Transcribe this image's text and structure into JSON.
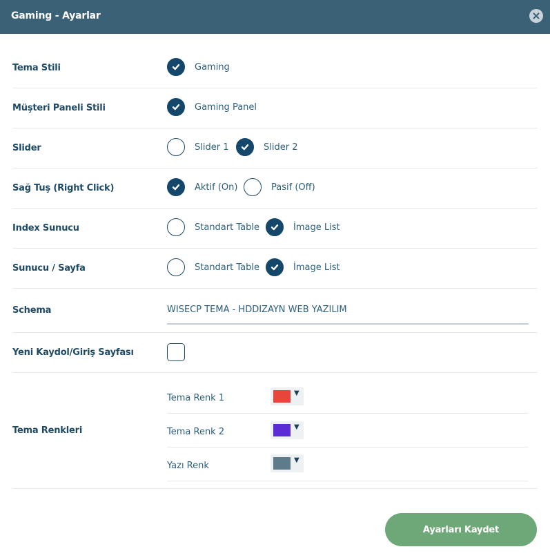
{
  "header": {
    "title": "Gaming - Ayarlar"
  },
  "rows": {
    "tema_stili": {
      "label": "Tema Stili",
      "options": [
        {
          "label": "Gaming",
          "checked": true
        }
      ]
    },
    "musteri_paneli": {
      "label": "Müşteri Paneli Stili",
      "options": [
        {
          "label": "Gaming Panel",
          "checked": true
        }
      ]
    },
    "slider": {
      "label": "Slider",
      "options": [
        {
          "label": "Slider 1",
          "checked": false
        },
        {
          "label": "Slider 2",
          "checked": true
        }
      ]
    },
    "sag_tus": {
      "label": "Sağ Tuş (Right Click)",
      "options": [
        {
          "label": "Aktif (On)",
          "checked": true
        },
        {
          "label": "Pasif (Off)",
          "checked": false
        }
      ]
    },
    "index_sunucu": {
      "label": "Index Sunucu",
      "options": [
        {
          "label": "Standart Table",
          "checked": false
        },
        {
          "label": "İmage List",
          "checked": true
        }
      ]
    },
    "sunucu_sayfa": {
      "label": "Sunucu / Sayfa",
      "options": [
        {
          "label": "Standart Table",
          "checked": false
        },
        {
          "label": "İmage List",
          "checked": true
        }
      ]
    },
    "schema": {
      "label": "Schema",
      "value": "WISECP TEMA - HDDIZAYN WEB YAZILIM"
    },
    "yeni_kaydol": {
      "label": "Yeni Kaydol/Giriş Sayfası",
      "checked": false
    },
    "tema_renkleri": {
      "label": "Tema Renkleri",
      "colors": [
        {
          "label": "Tema Renk 1",
          "color": "#e8453c"
        },
        {
          "label": "Tema Renk 2",
          "color": "#5b2bd6"
        },
        {
          "label": "Yazı Renk",
          "color": "#5e7b8b"
        }
      ]
    }
  },
  "save_button": {
    "label": "Ayarları Kaydet"
  },
  "colors": {
    "header": "#3b6176",
    "accent": "#14476a",
    "save": "#6fa878"
  },
  "icons": {
    "close": "close-icon",
    "check": "check-icon",
    "caret": "caret-down-icon"
  }
}
